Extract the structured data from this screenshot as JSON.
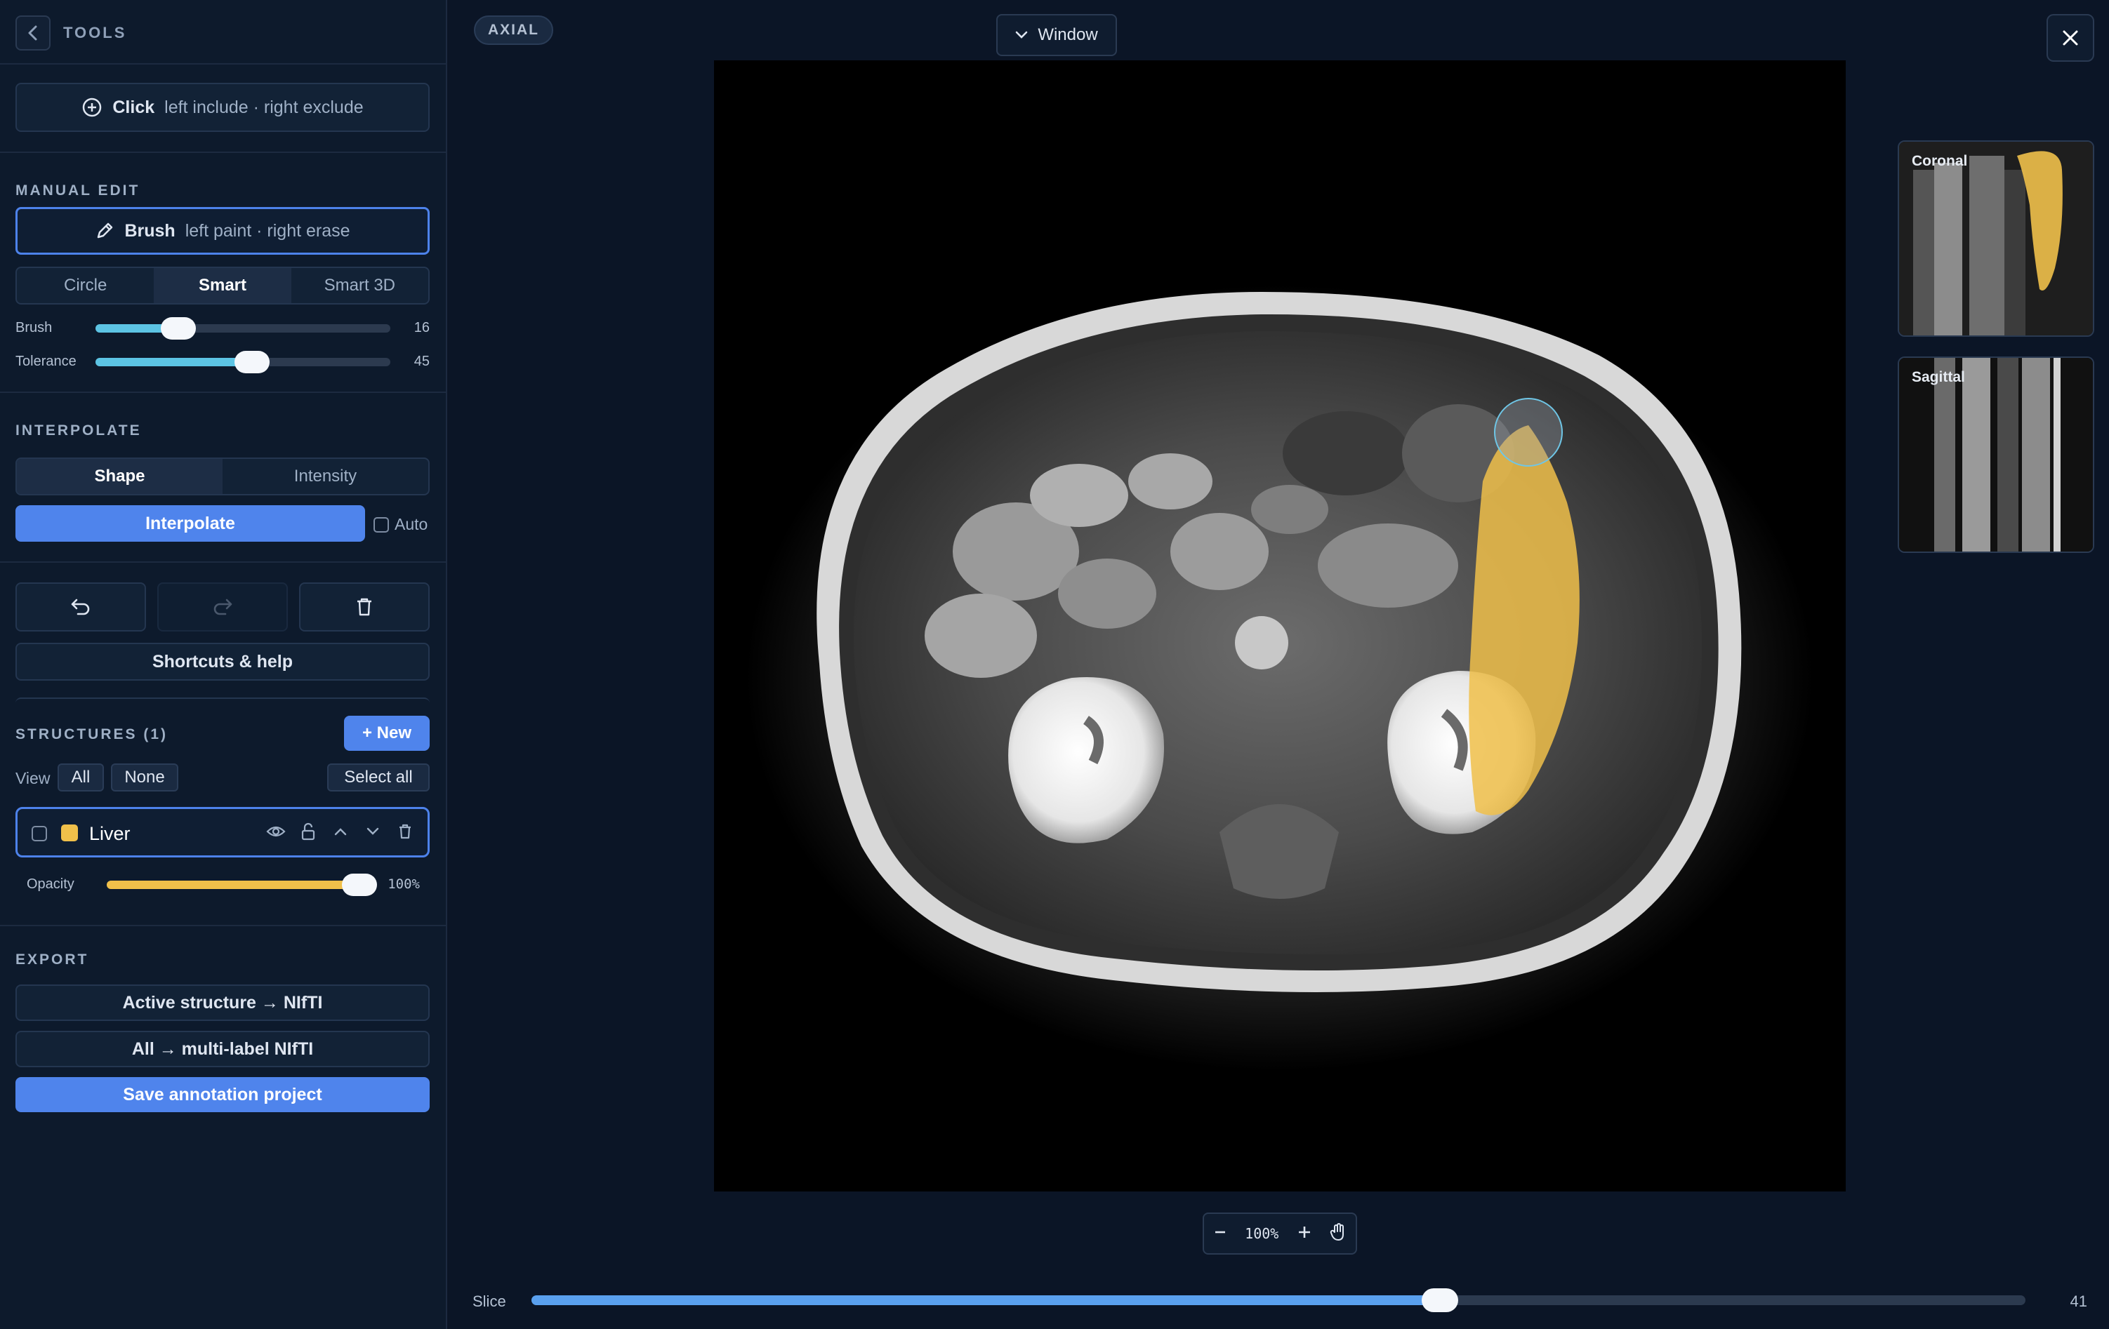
{
  "sidebar": {
    "header": {
      "title": "TOOLS"
    },
    "click_tool": {
      "label": "Click",
      "hint": "left include · right exclude"
    },
    "manual_edit": {
      "section": "MANUAL EDIT",
      "brush_tool": {
        "label": "Brush",
        "hint": "left paint · right erase"
      },
      "modes": [
        "Circle",
        "Smart",
        "Smart 3D"
      ],
      "active_mode": "Smart",
      "brush": {
        "label": "Brush",
        "value": "16",
        "fraction": 0.28
      },
      "tolerance": {
        "label": "Tolerance",
        "value": "45",
        "fraction": 0.53
      }
    },
    "interpolate": {
      "section": "INTERPOLATE",
      "modes": [
        "Shape",
        "Intensity"
      ],
      "active_mode": "Shape",
      "button": "Interpolate",
      "auto_label": "Auto"
    },
    "actions": {
      "help": "Shortcuts & help"
    },
    "structures": {
      "section": "STRUCTURES",
      "count": "(1)",
      "new_button": "+ New",
      "view_label": "View",
      "view_all": "All",
      "view_none": "None",
      "select_all": "Select all",
      "items": [
        {
          "name": "Liver",
          "color": "#f0c04a"
        }
      ],
      "opacity": {
        "label": "Opacity",
        "value": "100%",
        "fraction": 1.0
      }
    },
    "export": {
      "section": "EXPORT",
      "active_nifti": "Active structure → NIfTI",
      "all_nifti": "All → multi-label NIfTI",
      "save_project": "Save annotation project"
    }
  },
  "viewer": {
    "view_badge": "AXIAL",
    "window_button": "Window",
    "zoom": "100%",
    "thumbnails": {
      "coronal": "Coronal",
      "sagittal": "Sagittal"
    },
    "slice": {
      "label": "Slice",
      "value": "41",
      "fraction": 0.608
    }
  },
  "colors": {
    "accent": "#4f84ec",
    "slider": "#5cc4e4",
    "segmentation": "#f0c04a"
  }
}
